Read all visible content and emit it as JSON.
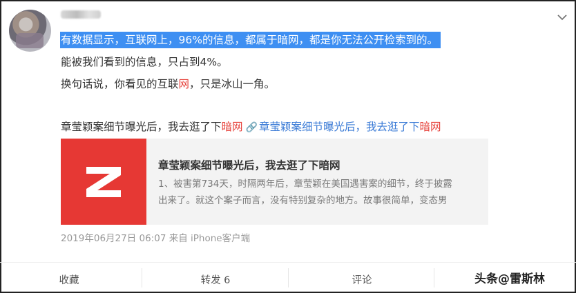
{
  "post": {
    "chevron_icon": "chevron-down-icon",
    "lines": {
      "l1": "有数据显示，互联网上，96%的信息，都属于暗网，都是你无法公开检索到的。",
      "l2": "能被我们看到的信息，只占到4%。",
      "l3_pre": "换句话说，你看见的互联",
      "l3_red": "网",
      "l3_post": "，只是冰山一角。",
      "l4_pre": "章莹颖案细节曝光后，我去逛了下",
      "l4_red": "暗网",
      "l4_link_pre": "章莹颖案细节曝光后，我去逛了下",
      "l4_link_red": "暗网"
    },
    "link_icon": "link-icon"
  },
  "card": {
    "thumb_icon": "z-logo",
    "title": "章莹颖案细节曝光后，我去逛了下暗网",
    "desc_line1": "1、被害第734天，时隔两年后，章莹颖在美国遇害案的细节，终于披露",
    "desc_line2": "出来了。就这个案子而言，没有特别复杂的地方。故事很简单，变态男"
  },
  "meta": {
    "date": "2019年06月27日 06:07",
    "source": "来自 iPhone客户端"
  },
  "actions": {
    "collect": "收藏",
    "repost": "转发 6",
    "comment": "评论"
  },
  "watermark": "头条@雷斯林",
  "colors": {
    "highlight": "#3e8ff2",
    "red": "#e6413a",
    "link_blue": "#3b7bd6",
    "thumb_red": "#e63834"
  }
}
